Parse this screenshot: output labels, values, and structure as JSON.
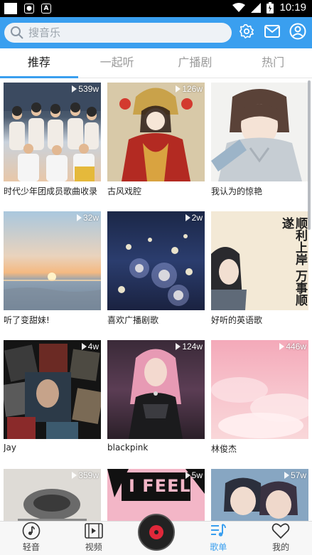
{
  "status_bar": {
    "time": "10:19"
  },
  "search": {
    "placeholder": "搜音乐"
  },
  "tabs": [
    {
      "label": "推荐",
      "active": true
    },
    {
      "label": "一起听",
      "active": false
    },
    {
      "label": "广播剧",
      "active": false
    },
    {
      "label": "热门",
      "active": false
    }
  ],
  "playlists": [
    {
      "title": "时代少年团成员歌曲收录",
      "plays": "539w",
      "icon": "boy-group-photo"
    },
    {
      "title": "古风戏腔",
      "plays": "126w",
      "icon": "ancient-costume-girl"
    },
    {
      "title": "我认为的惊艳",
      "plays": "",
      "icon": "anime-boy-hoodie"
    },
    {
      "title": "听了变甜妹!",
      "plays": "32w",
      "icon": "sunset-sea"
    },
    {
      "title": "喜欢广播剧歌",
      "plays": "2w",
      "icon": "lanterns-water"
    },
    {
      "title": "好听的英语歌",
      "plays": "",
      "icon": "calligraphy-girl"
    },
    {
      "title": "Jay",
      "plays": "4w",
      "icon": "album-covers-collage"
    },
    {
      "title": "blackpink",
      "plays": "124w",
      "icon": "singer-stage"
    },
    {
      "title": "林俊杰",
      "plays": "446w",
      "icon": "pink-clouds"
    },
    {
      "title": "",
      "plays": "359w",
      "icon": "vintage-objects"
    },
    {
      "title": "",
      "plays": "5w",
      "icon": "feel-poster"
    },
    {
      "title": "",
      "plays": "57w",
      "icon": "anime-couple"
    }
  ],
  "calligraphy_text": "顺利上岸 万事顺遂",
  "feel_text": "I FEEL",
  "bottom_nav": [
    {
      "label": "轻音",
      "icon": "music-note-icon",
      "active": false
    },
    {
      "label": "视频",
      "icon": "film-icon",
      "active": false
    },
    {
      "label": "歌单",
      "icon": "playlist-icon",
      "active": true
    },
    {
      "label": "我的",
      "icon": "heart-icon",
      "active": false
    }
  ],
  "colors": {
    "accent": "#3a9fef",
    "record_red": "#e0283a"
  }
}
